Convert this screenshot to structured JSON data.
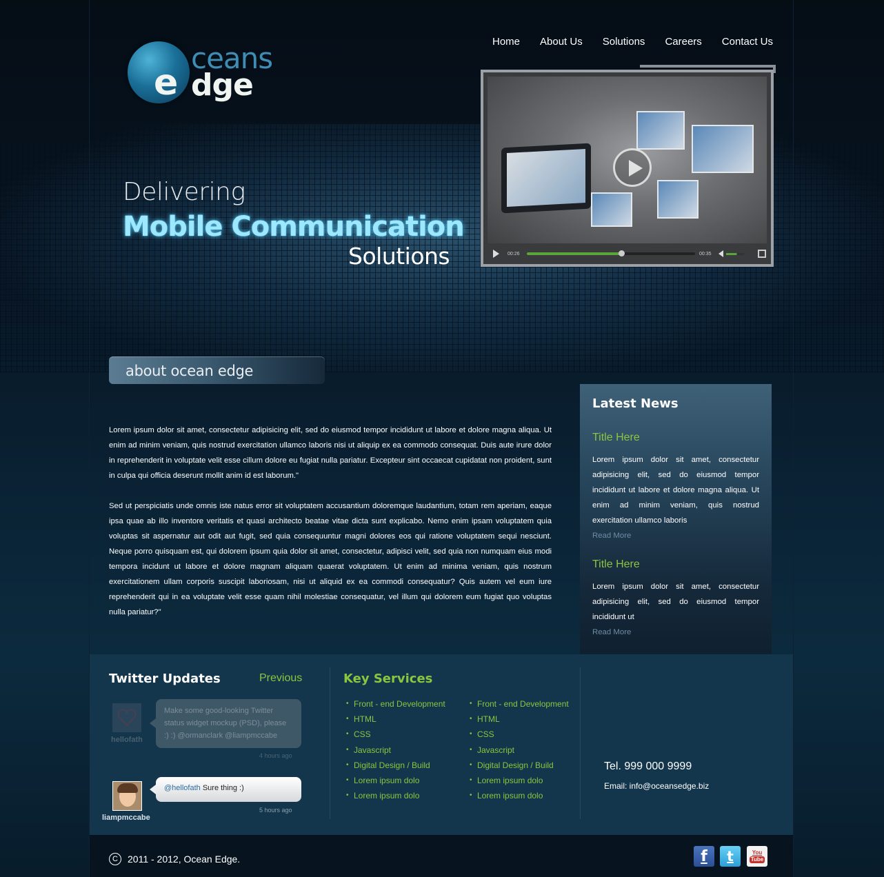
{
  "brand": {
    "logo_top": "ceans",
    "logo_letter": "e",
    "logo_bottom": "dge"
  },
  "nav": [
    "Home",
    "About Us",
    "Solutions",
    "Careers",
    "Contact Us"
  ],
  "hero": {
    "line1": "Delivering",
    "line2": "Mobile Communication",
    "line3": "Solutions"
  },
  "video": {
    "current_time": "00:26",
    "duration": "00:35",
    "progress": 0.56,
    "volume": 0.6
  },
  "about": {
    "heading": "about ocean edge",
    "paragraphs": [
      "Lorem ipsum dolor sit amet, consectetur adipisicing elit, sed do eiusmod tempor incididunt ut labore et dolore magna aliqua. Ut enim ad minim veniam, quis nostrud exercitation ullamco laboris nisi ut aliquip ex ea commodo consequat. Duis aute irure dolor in reprehenderit in voluptate velit esse cillum dolore eu fugiat nulla pariatur. Excepteur sint occaecat cupidatat non proident, sunt in culpa qui officia deserunt mollit anim id est laborum.\"",
      "Sed ut perspiciatis unde omnis iste natus error sit voluptatem accusantium doloremque laudantium, totam rem aperiam, eaque ipsa quae ab illo inventore veritatis et quasi architecto beatae vitae dicta sunt explicabo. Nemo enim ipsam voluptatem quia voluptas sit aspernatur aut odit aut fugit, sed quia consequuntur magni dolores eos qui ratione voluptatem sequi nesciunt. Neque porro quisquam est, qui dolorem ipsum quia dolor sit amet, consectetur, adipisci velit, sed quia non numquam eius modi tempora incidunt ut labore et dolore magnam aliquam quaerat voluptatem. Ut enim ad minima veniam, quis nostrum exercitationem ullam corporis suscipit laboriosam, nisi ut aliquid ex ea commodi consequatur? Quis autem vel eum iure reprehenderit qui in ea voluptate velit esse quam nihil molestiae consequatur, vel illum qui dolorem eum fugiat quo voluptas nulla pariatur?\""
    ]
  },
  "news": {
    "heading": "Latest News",
    "items": [
      {
        "title": "Title Here",
        "body": "Lorem ipsum dolor sit amet, consectetur adipisicing elit, sed do eiusmod tempor incididunt ut labore et dolore magna aliqua. Ut enim ad minim veniam, quis nostrud exercitation ullamco laboris",
        "link": "Read More"
      },
      {
        "title": "Title Here",
        "body": "Lorem ipsum dolor sit amet, consectetur adipisicing elit, sed do eiusmod tempor incididunt ut",
        "link": "Read More"
      }
    ]
  },
  "twitter": {
    "heading": "Twitter Updates",
    "previous": "Previous",
    "tweets": [
      {
        "user": "hellofath",
        "text": "Make some good-looking Twitter status widget mockup (PSD), please :) :) @ormanclark @liampmccabe",
        "time": "4 hours ago"
      },
      {
        "user": "liampmccabe",
        "mention": "@hellofath",
        "text": " Sure thing :)",
        "time": "5 hours ago"
      }
    ]
  },
  "services": {
    "heading": "Key Services",
    "col1": [
      "Front - end Development",
      "HTML",
      "CSS",
      "Javascript",
      "Digital Design / Build",
      "Lorem ipsum dolo",
      "Lorem ipsum dolo"
    ],
    "col2": [
      "Front - end Development",
      "HTML",
      "CSS",
      "Javascript",
      "Digital Design / Build",
      "Lorem ipsum dolo",
      "Lorem ipsum dolo"
    ]
  },
  "contact": {
    "tel": "Tel. 999 000 9999",
    "email": "Email: info@oceansedge.biz"
  },
  "footer": {
    "copyright_symbol": "C",
    "copyright": "2011 - 2012, Ocean Edge.",
    "social": [
      {
        "icon": "facebook-icon",
        "glyph": "f"
      },
      {
        "icon": "twitter-icon",
        "glyph": "t"
      },
      {
        "icon": "youtube-icon",
        "glyph_top": "You",
        "glyph_bottom": "Tube"
      }
    ]
  },
  "colors": {
    "accent_green": "#8cc63f",
    "brand_blue": "#3f8db4",
    "panel_blue": "#13364d"
  }
}
